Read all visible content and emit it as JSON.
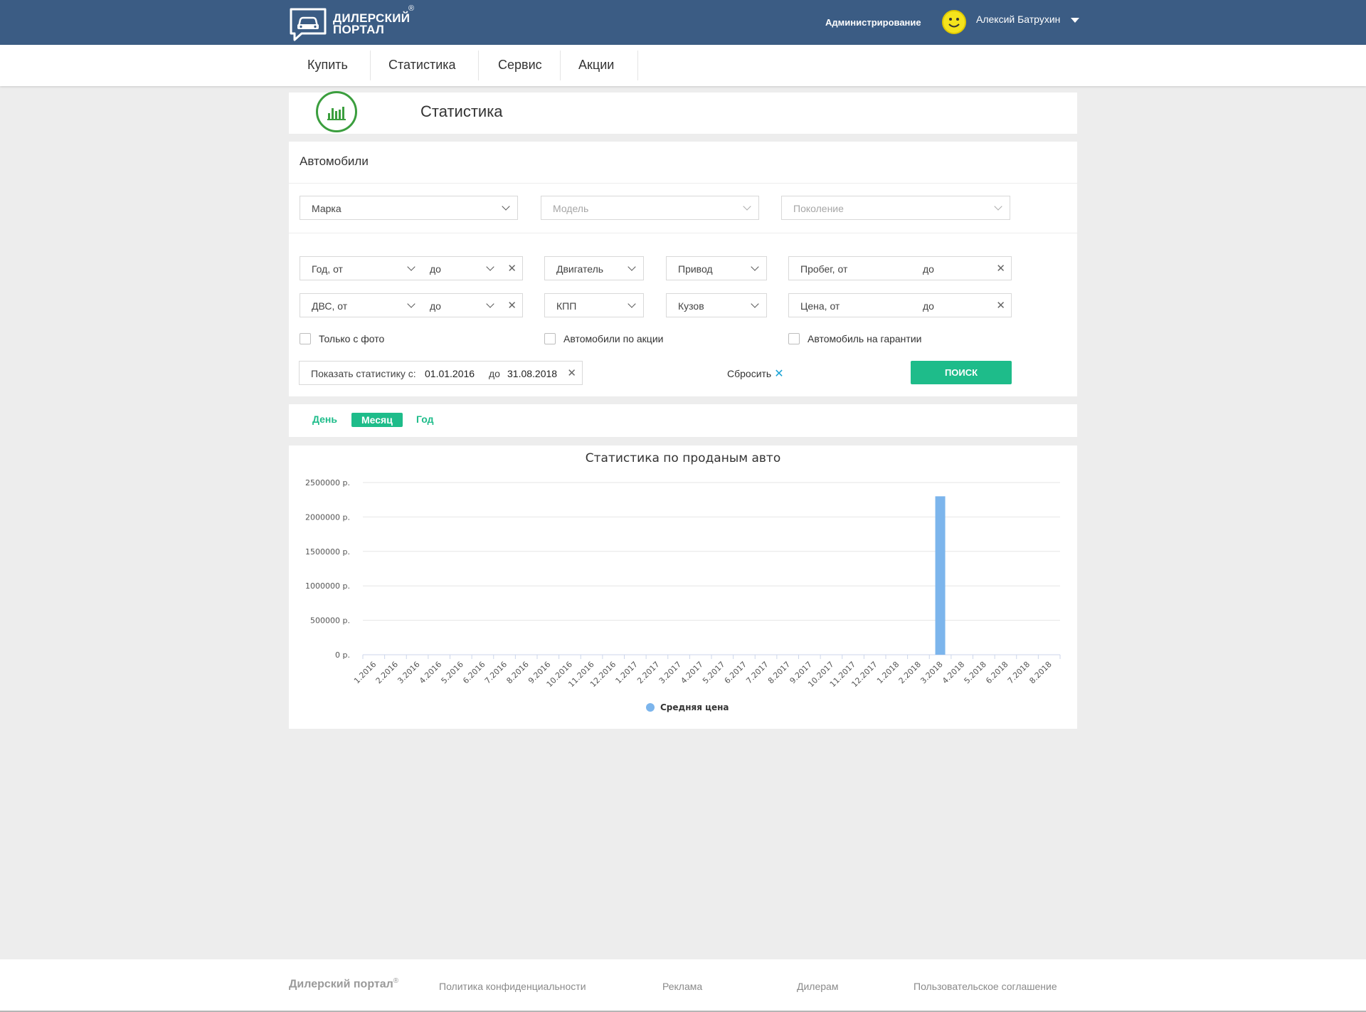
{
  "header": {
    "logo_line1": "ДИЛЕРСКИЙ",
    "logo_line2": "ПОРТАЛ",
    "logo_reg": "®",
    "admin_label": "Администрирование",
    "user_name": "Алексий Батрухин",
    "colors": {
      "bar": "#3b5c84"
    }
  },
  "nav": {
    "items": [
      {
        "label": "Купить"
      },
      {
        "label": "Статистика"
      },
      {
        "label": "Сервис"
      },
      {
        "label": "Акции"
      }
    ]
  },
  "page": {
    "title": "Статистика",
    "icon": "bar-chart-icon"
  },
  "filters": {
    "section_title": "Автомобили",
    "brand": "Марка",
    "model": "Модель",
    "generation": "Поколение",
    "year_from": "Год, от",
    "year_to": "до",
    "engine": "Двигатель",
    "drive": "Привод",
    "mileage_from": "Пробег, от",
    "mileage_to": "до",
    "ice_from": "ДВС, от",
    "ice_to": "до",
    "gearbox": "КПП",
    "body": "Кузов",
    "price_from": "Цена, от",
    "price_to": "до",
    "only_photo": "Только с фото",
    "on_sale": "Автомобили по акции",
    "warranty": "Автомобиль на гарантии",
    "date_label": "Показать статистику с:",
    "date_from": "01.01.2016",
    "date_to_label": "до",
    "date_to": "31.08.2018",
    "reset_label": "Сбросить",
    "search_label": "ПОИСК",
    "accent": "#1ebc8a"
  },
  "periods": {
    "day": "День",
    "month": "Месяц",
    "year": "Год",
    "active": "month"
  },
  "chart_data": {
    "type": "bar",
    "title": "Статистика по проданым авто",
    "xlabel": "",
    "ylabel": "",
    "ylim": [
      0,
      2500000
    ],
    "yticks": [
      "0 р.",
      "500000 р.",
      "1000000 р.",
      "1500000 р.",
      "2000000 р.",
      "2500000 р."
    ],
    "grid": true,
    "legend_position": "bottom",
    "categories": [
      "1.2016",
      "2.2016",
      "3.2016",
      "4.2016",
      "5.2016",
      "6.2016",
      "7.2016",
      "8.2016",
      "9.2016",
      "10.2016",
      "11.2016",
      "12.2016",
      "1.2017",
      "2.2017",
      "3.2017",
      "4.2017",
      "5.2017",
      "6.2017",
      "7.2017",
      "8.2017",
      "9.2017",
      "10.2017",
      "11.2017",
      "12.2017",
      "1.2018",
      "2.2018",
      "3.2018",
      "4.2018",
      "5.2018",
      "6.2018",
      "7.2018",
      "8.2018"
    ],
    "series": [
      {
        "name": "Средняя цена",
        "color": "#7cb5ec",
        "values": [
          0,
          0,
          0,
          0,
          0,
          0,
          0,
          0,
          0,
          0,
          0,
          0,
          0,
          0,
          0,
          0,
          0,
          0,
          0,
          0,
          0,
          0,
          0,
          0,
          0,
          0,
          2300000,
          0,
          0,
          0,
          0,
          0
        ]
      }
    ]
  },
  "footer": {
    "logo": "Дилерский портал",
    "logo_reg": "®",
    "links": [
      {
        "label": "Политика конфиденциальности"
      },
      {
        "label": "Реклама"
      },
      {
        "label": "Дилерам"
      },
      {
        "label": "Пользовательское соглашение"
      }
    ]
  }
}
